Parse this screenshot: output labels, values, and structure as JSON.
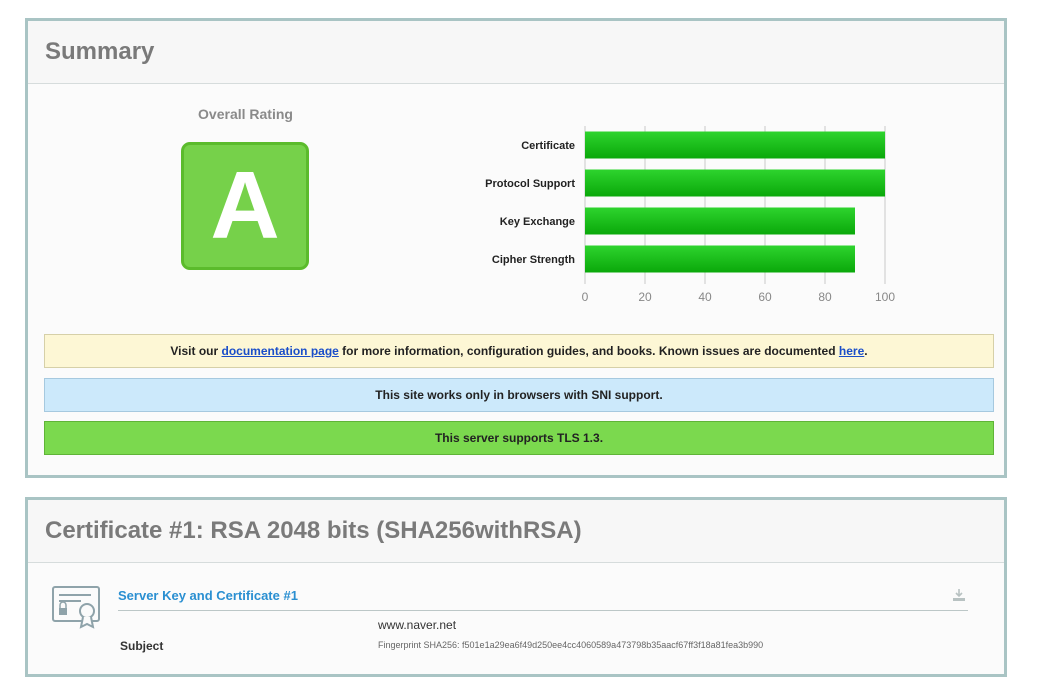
{
  "summary": {
    "title": "Summary",
    "overall_rating_label": "Overall Rating",
    "grade": "A"
  },
  "chart_data": {
    "type": "bar",
    "orientation": "horizontal",
    "categories": [
      "Certificate",
      "Protocol Support",
      "Key Exchange",
      "Cipher Strength"
    ],
    "values": [
      100,
      100,
      90,
      90
    ],
    "xlim": [
      0,
      100
    ],
    "xticks": [
      0,
      20,
      40,
      60,
      80,
      100
    ],
    "grid": true,
    "bar_color": "#1fbd1f"
  },
  "notices": {
    "docs": {
      "prefix": "Visit our ",
      "link1": "documentation page",
      "middle": " for more information, configuration guides, and books. Known issues are documented ",
      "link2": "here",
      "suffix": "."
    },
    "sni": "This site works only in browsers with SNI support.",
    "tls": "This server supports TLS 1.3."
  },
  "certificate": {
    "title": "Certificate #1: RSA 2048 bits (SHA256withRSA)",
    "section_title": "Server Key and Certificate #1",
    "subject_label": "Subject",
    "subject_cn": "www.naver.net",
    "fingerprint": "Fingerprint SHA256: f501e1a29ea6f49d250ee4cc4060589a473798b35aacf67ff3f18a81fea3b990",
    "icons": [
      "certificate-icon",
      "download-icon"
    ]
  },
  "colors": {
    "panel_border": "#a9c4c4",
    "grade_green": "#76d14a",
    "link_blue": "#1a4ec9",
    "section_blue": "#2a8fd1"
  }
}
